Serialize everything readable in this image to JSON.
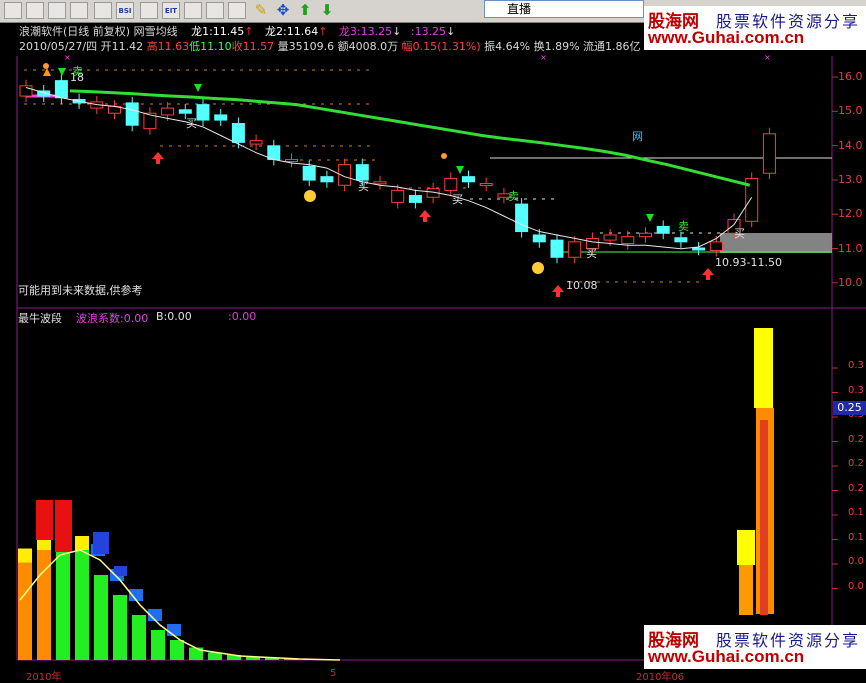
{
  "toolbar": {
    "buttons": [
      "BSI",
      "EIT",
      "BSI"
    ],
    "tab_label": "直播"
  },
  "watermark": {
    "brand": "股海网",
    "slogan": "股票软件资源分享",
    "url": "www.Guhai.com.cn"
  },
  "header": {
    "software": "浪潮软件(日线 前复权)",
    "indicator": "网雪均线",
    "long1": "龙1:11.45",
    "long2": "龙2:11.64",
    "long3": "龙3:13.25",
    "long3_val": ":13.25",
    "date": "2010/05/27/四",
    "open": "开11.42",
    "high": "高11.63",
    "low": "低11.10",
    "close": "收11.57",
    "volume": "量35109.6",
    "amount": "额4008.0万",
    "change": "幅0.15(1.31%)",
    "amplitude": "振4.64%",
    "turnover": "换1.89%",
    "circulation": "流通1.86亿"
  },
  "main_chart": {
    "price_labels": [
      "16.0",
      "15.0",
      "14.0",
      "13.0",
      "12.0",
      "11.0",
      "10.0"
    ],
    "warning": "可能用到未来数据,供参考",
    "annotations": {
      "buy": "买",
      "sell": "卖",
      "net": "网",
      "range": "10.93-11.50",
      "low": "10.08",
      "top": "18"
    }
  },
  "sub_chart": {
    "name": "最牛波段",
    "coef": "波浪系数:0.00",
    "b": "B:0.00",
    "extra": ":0.00",
    "labels": [
      "0.3",
      "0.3",
      "0.3",
      "0.2",
      "0.2",
      "0.2",
      "0.1",
      "0.1",
      "0.0",
      "0.0"
    ],
    "highlight": "0.25"
  },
  "timeline": {
    "year": "2010年",
    "month": "5",
    "mid": "2010年06"
  },
  "chart_data": {
    "type": "candlestick",
    "candles": [
      {
        "o": 15.45,
        "c": 15.75
      },
      {
        "o": 15.6,
        "c": 15.45
      },
      {
        "o": 15.9,
        "c": 15.4
      },
      {
        "o": 15.35,
        "c": 15.25
      },
      {
        "o": 15.1,
        "c": 15.28
      },
      {
        "o": 14.95,
        "c": 15.15
      },
      {
        "o": 15.25,
        "c": 14.6
      },
      {
        "o": 14.5,
        "c": 14.95
      },
      {
        "o": 14.9,
        "c": 15.1
      },
      {
        "o": 15.05,
        "c": 14.95
      },
      {
        "o": 15.2,
        "c": 14.75
      },
      {
        "o": 14.9,
        "c": 14.75
      },
      {
        "o": 14.65,
        "c": 14.1
      },
      {
        "o": 14.05,
        "c": 14.15
      },
      {
        "o": 14.0,
        "c": 13.6
      },
      {
        "o": 13.55,
        "c": 13.6
      },
      {
        "o": 13.4,
        "c": 13.0
      },
      {
        "o": 13.1,
        "c": 12.95
      },
      {
        "o": 12.85,
        "c": 13.45
      },
      {
        "o": 13.45,
        "c": 13.0
      },
      {
        "o": 12.9,
        "c": 12.95
      },
      {
        "o": 12.35,
        "c": 12.7
      },
      {
        "o": 12.55,
        "c": 12.35
      },
      {
        "o": 12.5,
        "c": 12.75
      },
      {
        "o": 12.7,
        "c": 13.05
      },
      {
        "o": 13.1,
        "c": 12.95
      },
      {
        "o": 12.85,
        "c": 12.9
      },
      {
        "o": 12.5,
        "c": 12.6
      },
      {
        "o": 12.3,
        "c": 11.5
      },
      {
        "o": 11.4,
        "c": 11.2
      },
      {
        "o": 11.25,
        "c": 10.75
      },
      {
        "o": 10.75,
        "c": 11.2
      },
      {
        "o": 11.0,
        "c": 11.3
      },
      {
        "o": 11.25,
        "c": 11.4
      },
      {
        "o": 11.15,
        "c": 11.35
      },
      {
        "o": 11.35,
        "c": 11.45
      },
      {
        "o": 11.65,
        "c": 11.45
      },
      {
        "o": 11.32,
        "c": 11.2
      },
      {
        "o": 11.02,
        "c": 10.98
      },
      {
        "o": 10.95,
        "c": 11.2
      },
      {
        "o": 11.45,
        "c": 11.85
      },
      {
        "o": 11.8,
        "c": 13.05
      },
      {
        "o": 13.2,
        "c": 14.35
      }
    ],
    "ma_green": [
      15.6,
      15.58,
      15.55,
      15.52,
      15.48,
      15.45,
      15.42,
      15.38,
      15.35,
      15.3,
      15.25,
      15.2,
      15.1,
      15.0,
      14.9,
      14.8,
      14.7,
      14.6,
      14.5,
      14.4,
      14.3,
      14.22,
      14.15,
      14.08,
      14.0,
      13.92,
      13.83,
      13.72,
      13.58,
      13.45,
      13.3,
      13.15,
      13.0,
      12.85
    ],
    "ma_white": [
      15.7,
      15.55,
      15.4,
      15.3,
      15.2,
      15.15,
      15.05,
      14.9,
      14.8,
      14.7,
      14.55,
      14.3,
      14.05,
      13.8,
      13.6,
      13.5,
      13.45,
      13.35,
      13.1,
      12.95,
      12.85,
      12.8,
      12.7,
      12.65,
      12.55,
      12.4,
      12.2,
      11.95,
      11.7,
      11.5,
      11.4,
      11.3,
      11.2,
      11.15,
      11.1,
      11.1,
      11.05,
      11.0,
      11.05,
      11.3,
      11.7,
      12.5
    ],
    "wave_bars": [
      {
        "h": 0.195,
        "top": 0.0,
        "c": "orange"
      },
      {
        "h": 0.22,
        "top": 0.08,
        "c": "orange"
      },
      {
        "h": 0.24,
        "top": 0.06,
        "c": "green"
      },
      {
        "h": 0.22,
        "top": 0.05,
        "c": "green"
      },
      {
        "h": 0.17,
        "top": 0.0,
        "c": "green"
      },
      {
        "h": 0.13,
        "top": 0.0,
        "c": "green"
      },
      {
        "h": 0.09,
        "top": 0.0,
        "c": "green"
      },
      {
        "h": 0.06,
        "top": 0.0,
        "c": "green"
      },
      {
        "h": 0.04,
        "top": 0.0,
        "c": "green"
      },
      {
        "h": 0.025,
        "top": 0.0,
        "c": "green"
      },
      {
        "h": 0.015,
        "top": 0.0,
        "c": "green"
      },
      {
        "h": 0.01,
        "top": 0.0,
        "c": "green"
      },
      {
        "h": 0.006,
        "top": 0.0,
        "c": "green"
      },
      {
        "h": 0.004,
        "top": 0.0,
        "c": "green"
      },
      {
        "h": 0.003,
        "top": 0.0,
        "c": "green"
      },
      {
        "h": 0.002,
        "top": 0.0,
        "c": "green"
      },
      {
        "h": 0.001,
        "top": 0.0,
        "c": "green"
      }
    ]
  }
}
